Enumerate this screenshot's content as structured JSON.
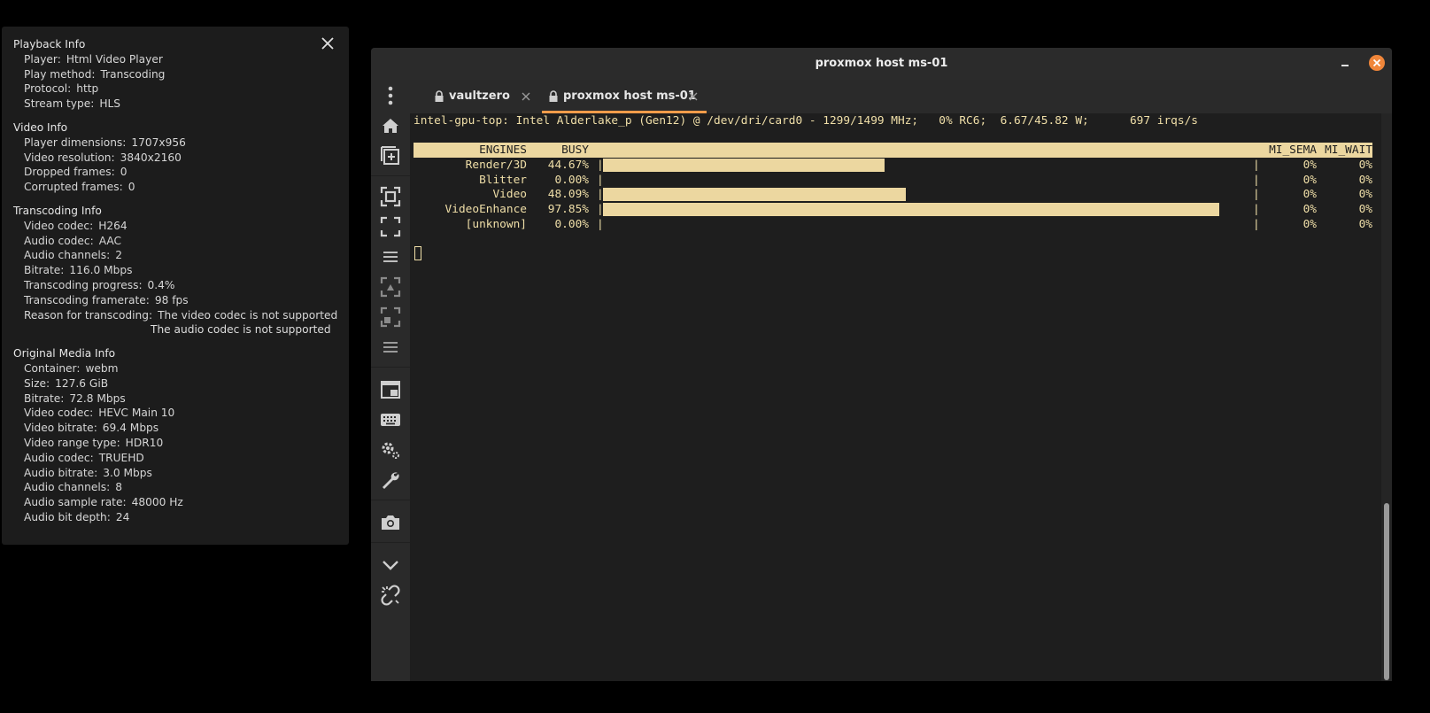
{
  "playback_info": {
    "sections": [
      {
        "title": "Playback Info",
        "rows": [
          {
            "label": "Player",
            "value": "Html Video Player"
          },
          {
            "label": "Play method",
            "value": "Transcoding"
          },
          {
            "label": "Protocol",
            "value": "http"
          },
          {
            "label": "Stream type",
            "value": "HLS"
          }
        ]
      },
      {
        "title": "Video Info",
        "rows": [
          {
            "label": "Player dimensions",
            "value": "1707x956"
          },
          {
            "label": "Video resolution",
            "value": "3840x2160"
          },
          {
            "label": "Dropped frames",
            "value": "0"
          },
          {
            "label": "Corrupted frames",
            "value": "0"
          }
        ]
      },
      {
        "title": "Transcoding Info",
        "rows": [
          {
            "label": "Video codec",
            "value": "H264"
          },
          {
            "label": "Audio codec",
            "value": "AAC"
          },
          {
            "label": "Audio channels",
            "value": "2"
          },
          {
            "label": "Bitrate",
            "value": "116.0 Mbps"
          },
          {
            "label": "Transcoding progress",
            "value": "0.4%"
          },
          {
            "label": "Transcoding framerate",
            "value": "98 fps"
          },
          {
            "label": "Reason for transcoding",
            "value": "The video codec is not supported",
            "extra": "The audio codec is not supported"
          }
        ]
      },
      {
        "title": "Original Media Info",
        "rows": [
          {
            "label": "Container",
            "value": "webm"
          },
          {
            "label": "Size",
            "value": "127.6 GiB"
          },
          {
            "label": "Bitrate",
            "value": "72.8 Mbps"
          },
          {
            "label": "Video codec",
            "value": "HEVC Main 10"
          },
          {
            "label": "Video bitrate",
            "value": "69.4 Mbps"
          },
          {
            "label": "Video range type",
            "value": "HDR10"
          },
          {
            "label": "Audio codec",
            "value": "TRUEHD"
          },
          {
            "label": "Audio bitrate",
            "value": "3.0 Mbps"
          },
          {
            "label": "Audio channels",
            "value": "8"
          },
          {
            "label": "Audio sample rate",
            "value": "48000 Hz"
          },
          {
            "label": "Audio bit depth",
            "value": "24"
          }
        ]
      }
    ]
  },
  "window": {
    "title": "proxmox host ms-01",
    "tabs": [
      {
        "label": "vaultzero",
        "active": false
      },
      {
        "label": "proxmox host ms-01",
        "active": true
      }
    ],
    "sidebar_icons": [
      "more-vert-icon",
      "home-icon",
      "add-tab-icon",
      "fit-screen-icon",
      "fullscreen-icon",
      "menu-icon",
      "fit-screen-dim-icon",
      "fullscreen-dim-icon",
      "menu-dim-icon",
      "picture-in-picture-icon",
      "keyboard-icon",
      "settings-icon",
      "wrench-icon",
      "camera-icon",
      "chevron-down-icon",
      "broken-link-icon"
    ]
  },
  "terminal": {
    "status_line": "intel-gpu-top: Intel Alderlake_p (Gen12) @ /dev/dri/card0 - 1299/1499 MHz;   0% RC6;  6.67/45.82 W;      697 irqs/s",
    "headers": {
      "engines": "ENGINES",
      "busy": "BUSY",
      "mi_sema": "MI_SEMA",
      "mi_wait": "MI_WAIT"
    },
    "engines": [
      {
        "name": "Render/3D",
        "busy": "44.67%",
        "busy_fraction": 0.4467,
        "sema": "0%",
        "wait": "0%"
      },
      {
        "name": "Blitter",
        "busy": "0.00%",
        "busy_fraction": 0.0,
        "sema": "0%",
        "wait": "0%"
      },
      {
        "name": "Video",
        "busy": "48.09%",
        "busy_fraction": 0.4809,
        "sema": "0%",
        "wait": "0%"
      },
      {
        "name": "VideoEnhance",
        "busy": "97.85%",
        "busy_fraction": 0.9785,
        "sema": "0%",
        "wait": "0%"
      },
      {
        "name": "[unknown]",
        "busy": "0.00%",
        "busy_fraction": 0.0,
        "sema": "0%",
        "wait": "0%"
      }
    ],
    "bar_separator": "|"
  }
}
